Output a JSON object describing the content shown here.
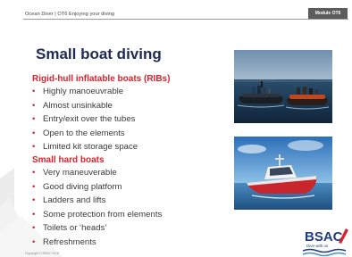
{
  "header": {
    "breadcrumb": "Ocean Diver  |  OT6 Enjoying your diving",
    "module_badge": "Module OT6"
  },
  "title": "Small boat diving",
  "sections": [
    {
      "heading": "Rigid-hull inflatable boats (RIBs)",
      "items": [
        "Highly manoeuvrable",
        "Almost unsinkable",
        "Entry/exit over the tubes",
        "Open to the elements",
        "Limited kit storage space"
      ]
    },
    {
      "heading": "Small hard boats",
      "items": [
        "Very maneuverable",
        "Good diving platform",
        "Ladders and lifts",
        "Some protection from elements",
        "Toilets or ‘heads’",
        "Refreshments"
      ]
    }
  ],
  "bullet_glyph": "•",
  "logo": {
    "name": "BSAC",
    "tagline": "Dive with us"
  },
  "footer": "Copyright © BSAC 2018",
  "colors": {
    "title": "#1f2a52",
    "accent": "#d9232e",
    "badge": "#5c5c5c"
  }
}
